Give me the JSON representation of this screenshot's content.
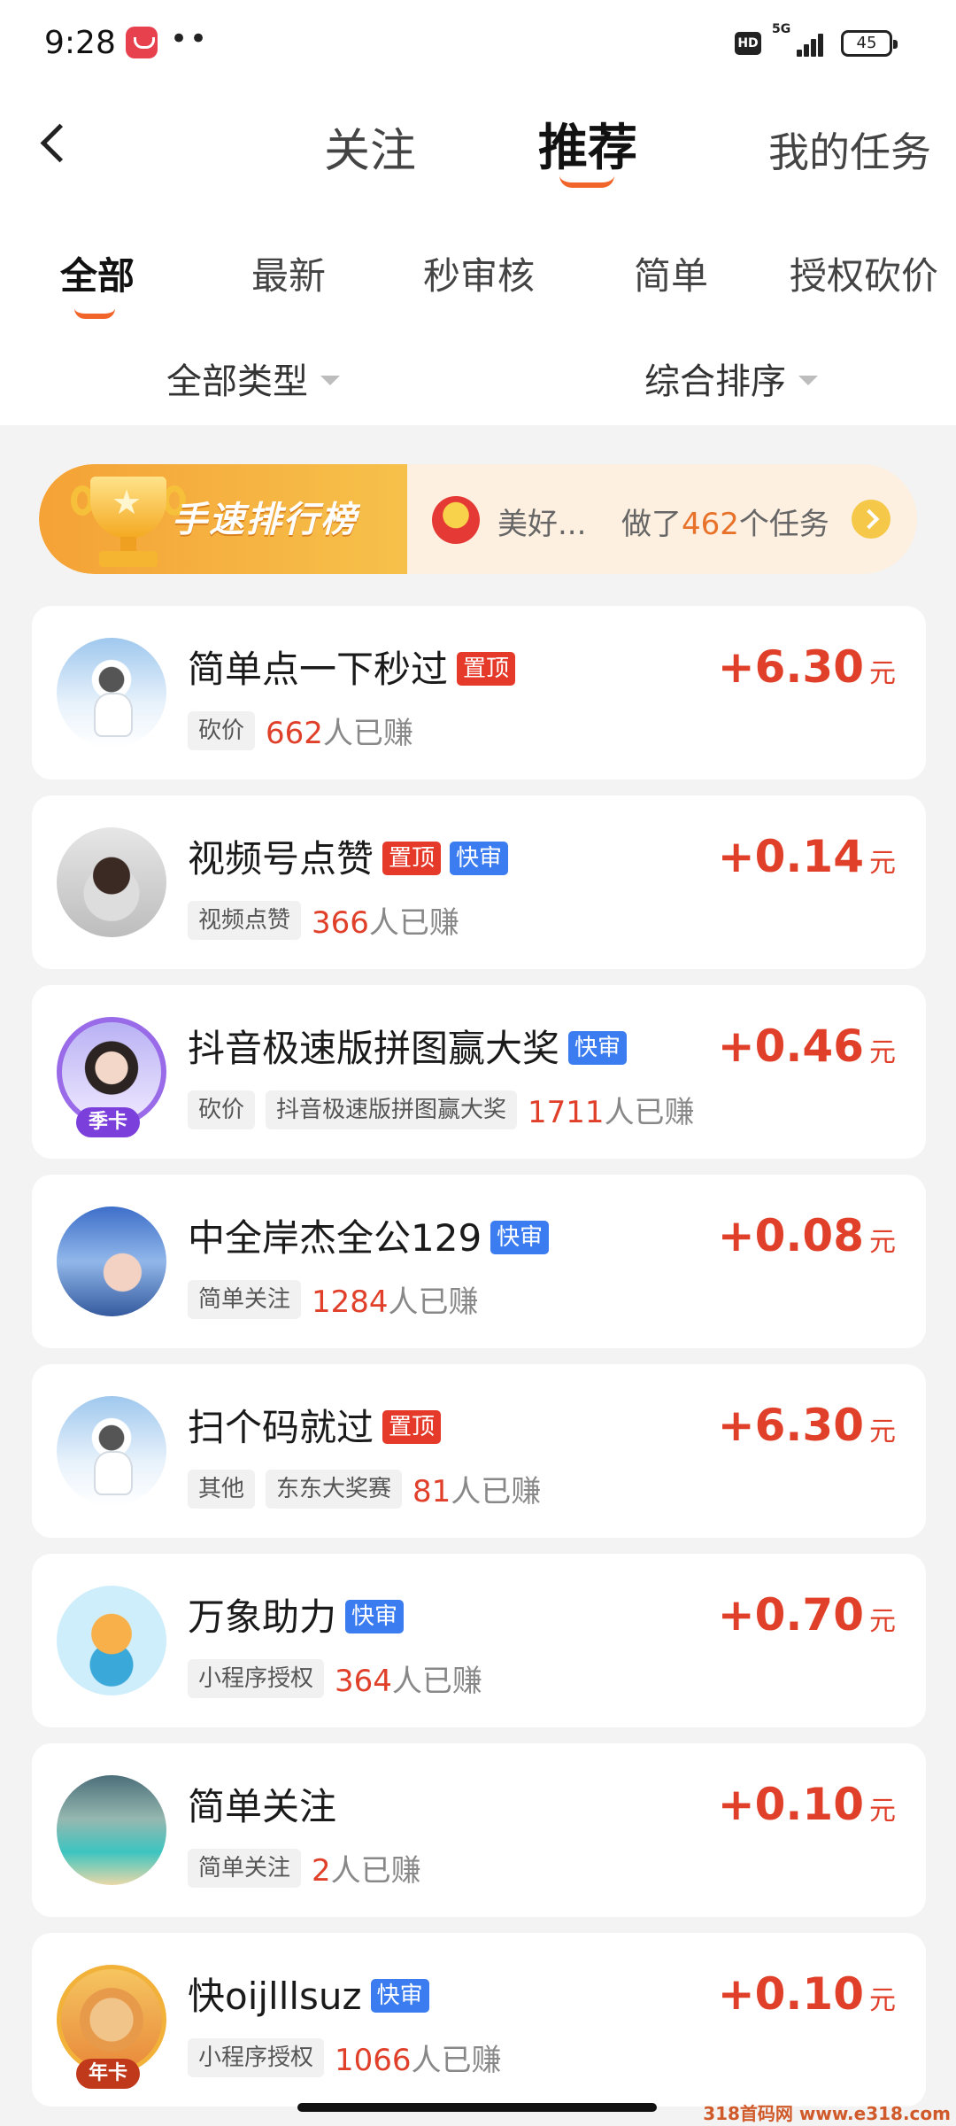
{
  "status": {
    "time": "9:28",
    "dots": "••",
    "hd": "HD",
    "network": "5G",
    "battery": "45"
  },
  "header": {
    "tabs": [
      "关注",
      "推荐",
      "我的任务"
    ]
  },
  "subtabs": [
    "全部",
    "最新",
    "秒审核",
    "简单",
    "授权砍价"
  ],
  "filters": {
    "type": "全部类型",
    "sort": "综合排序"
  },
  "rank_banner": {
    "title": "手速排行榜",
    "user": "美好...",
    "stat_prefix": "做了",
    "stat_count": "462",
    "stat_suffix": "个任务"
  },
  "tasks": [
    {
      "title": "简单点一下秒过",
      "tags": [
        "置顶"
      ],
      "chips": [
        "砍价"
      ],
      "count": "662",
      "earned": "人已赚",
      "amount": "+6.30",
      "unit": "元"
    },
    {
      "title": "视频号点赞",
      "tags": [
        "置顶",
        "快审"
      ],
      "chips": [
        "视频点赞"
      ],
      "count": "366",
      "earned": "人已赚",
      "amount": "+0.14",
      "unit": "元"
    },
    {
      "title": "抖音极速版拼图赢大奖",
      "tags": [
        "快审"
      ],
      "chips": [
        "砍价",
        "抖音极速版拼图赢大奖"
      ],
      "count": "1711",
      "earned": "人已赚",
      "amount": "+0.46",
      "unit": "元",
      "avatar_badge": "季卡"
    },
    {
      "title": "中全岸杰全公129",
      "tags": [
        "快审"
      ],
      "chips": [
        "简单关注"
      ],
      "count": "1284",
      "earned": "人已赚",
      "amount": "+0.08",
      "unit": "元"
    },
    {
      "title": "扫个码就过",
      "tags": [
        "置顶"
      ],
      "chips": [
        "其他",
        "东东大奖赛"
      ],
      "count": "81",
      "earned": "人已赚",
      "amount": "+6.30",
      "unit": "元"
    },
    {
      "title": "万象助力",
      "tags": [
        "快审"
      ],
      "chips": [
        "小程序授权"
      ],
      "count": "364",
      "earned": "人已赚",
      "amount": "+0.70",
      "unit": "元"
    },
    {
      "title": "简单关注",
      "tags": [],
      "chips": [
        "简单关注"
      ],
      "count": "2",
      "earned": "人已赚",
      "amount": "+0.10",
      "unit": "元"
    },
    {
      "title": "快oijlllsuz",
      "tags": [
        "快审"
      ],
      "chips": [
        "小程序授权"
      ],
      "count": "1066",
      "earned": "人已赚",
      "amount": "+0.10",
      "unit": "元",
      "avatar_badge": "年卡"
    }
  ],
  "watermark": "318首码网 www.e318.com"
}
